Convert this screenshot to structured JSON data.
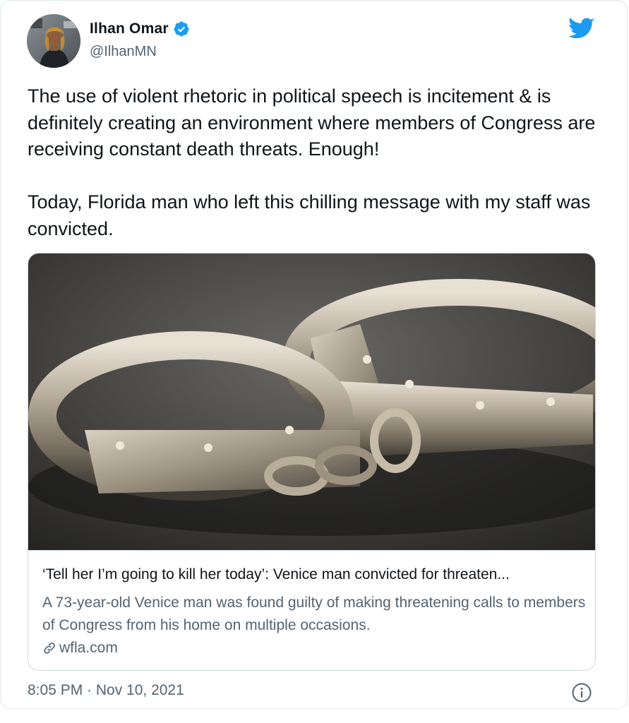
{
  "author": {
    "display_name": "Ilhan Omar",
    "handle": "@IlhanMN",
    "verified": true,
    "verified_icon": "verified-badge-icon",
    "avatar": "profile-photo"
  },
  "brand": {
    "icon": "twitter-bird-icon",
    "color": "#1d9bf0"
  },
  "tweet": {
    "text": "The use of violent rhetoric in political speech is incitement & is definitely creating an environment where members of Congress are receiving constant death threats. Enough!\n\nToday, Florida man who left this chilling message with my staff was convicted."
  },
  "card": {
    "image": "handcuffs-photo",
    "title": "‘Tell her I’m going to kill her today’: Venice man convicted for threaten...",
    "description": "A 73-year-old Venice man was found guilty of making threatening calls to members of Congress from his home on multiple occasions.",
    "domain": "wfla.com",
    "domain_icon": "link-icon"
  },
  "footer": {
    "timestamp": "8:05 PM · Nov 10, 2021",
    "info_icon": "info-icon"
  },
  "colors": {
    "text_primary": "#0f1419",
    "text_secondary": "#536471",
    "border": "#cfd9de",
    "accent": "#1d9bf0"
  }
}
